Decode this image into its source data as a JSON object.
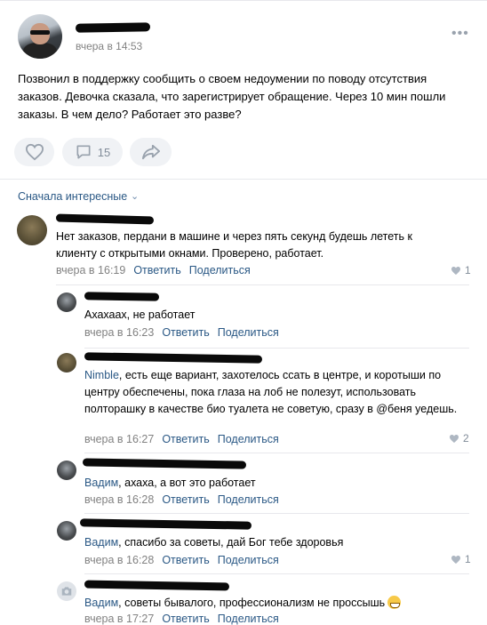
{
  "post": {
    "time": "вчера в 14:53",
    "text": "Позвонил в поддержку сообщить о своем недоумении по поводу отсутствия заказов. Девочка сказала, что зарегистрирует обращение. Через 10 мин пошли заказы. В чем дело? Работает это разве?",
    "comments_count": "15"
  },
  "sort": {
    "label": "Сначала интересные"
  },
  "comments": [
    {
      "text": "Нет заказов, пердани в машине и через пять секунд будешь лететь к клиенту с открытыми окнами. Проверено, работает.",
      "time": "вчера в 16:19",
      "reply": "Ответить",
      "share": "Поделиться",
      "likes": "1"
    },
    {
      "text": "Ахахаах, не работает",
      "time": "вчера в 16:23",
      "reply": "Ответить",
      "share": "Поделиться"
    },
    {
      "mention": "Nimble",
      "text": ", есть еще вариант, захотелось ссать в центре, и коротыши по центру обеспечены, пока глаза на лоб не полезут, использовать полторашку в качестве био туалета не советую, сразу в @беня уедешь.",
      "time": "вчера в 16:27",
      "reply": "Ответить",
      "share": "Поделиться",
      "likes": "2"
    },
    {
      "mention": "Вадим",
      "text": ", ахаха, а вот это работает",
      "time": "вчера в 16:28",
      "reply": "Ответить",
      "share": "Поделиться"
    },
    {
      "mention": "Вадим",
      "text": ", спасибо за советы, дай Бог тебе здоровья",
      "time": "вчера в 16:28",
      "reply": "Ответить",
      "share": "Поделиться",
      "likes": "1"
    },
    {
      "mention": "Вадим",
      "text": ", советы бывалого, профессионализм не проссышь",
      "time": "вчера в 17:27",
      "reply": "Ответить",
      "share": "Поделиться"
    }
  ],
  "colors": {
    "link": "#2a5885",
    "meta": "#828282",
    "button_bg": "#f0f2f5",
    "icon": "#99a2ad"
  },
  "icons": [
    "more-icon",
    "heart-icon",
    "comment-icon",
    "share-icon",
    "chevron-down-icon",
    "camera-icon",
    "grinning-emoji-icon"
  ]
}
